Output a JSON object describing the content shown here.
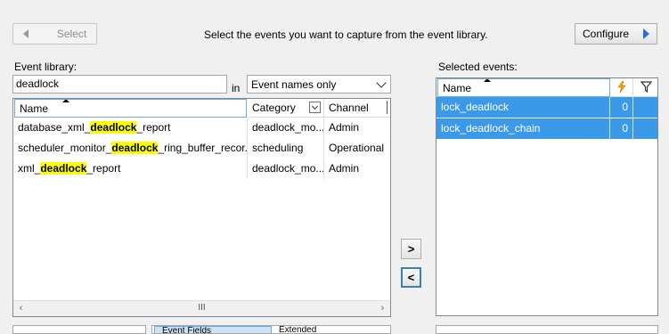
{
  "toolbar": {
    "select_label": "Select",
    "instruction": "Select the events you want to capture from the event library.",
    "configure_label": "Configure"
  },
  "library": {
    "label": "Event library:",
    "search_value": "deadlock",
    "in_label": "in",
    "filter_value": "Event names only",
    "columns": [
      "Name",
      "Category",
      "Channel"
    ],
    "rows": [
      {
        "name_before": "database_xml_",
        "name_match": "deadlock",
        "name_after": "_report",
        "category": "deadlock_mo...",
        "channel": "Admin"
      },
      {
        "name_before": "scheduler_monitor_",
        "name_match": "deadlock",
        "name_after": "_ring_buffer_recor...",
        "category": "scheduling",
        "channel": "Operational"
      },
      {
        "name_before": "xml_",
        "name_match": "deadlock",
        "name_after": "_report",
        "category": "deadlock_mo...",
        "channel": "Admin"
      }
    ],
    "scroll_thumb": "III"
  },
  "arrows": {
    "add": ">",
    "remove": "<"
  },
  "selected": {
    "label": "Selected events:",
    "columns": {
      "name": "Name"
    },
    "rows": [
      {
        "name": "lock_deadlock",
        "count": "0"
      },
      {
        "name": "lock_deadlock_chain",
        "count": "0"
      }
    ]
  },
  "bottom": {
    "tab_label": "Event Fields",
    "tab2_label": "Extended"
  },
  "icons": {
    "lightning": "lightning-icon",
    "filter": "filter-icon"
  },
  "colors": {
    "selection": "#3b99e9",
    "highlight": "#ffff00",
    "accent": "#2a6fd0"
  }
}
